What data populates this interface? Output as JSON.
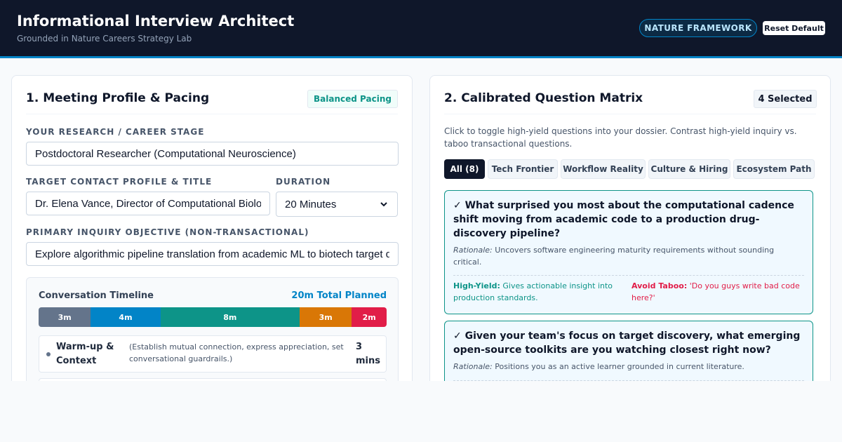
{
  "header": {
    "title": "Informational Interview Architect",
    "subtitle": "Grounded in Nature Careers Strategy Lab",
    "framework_badge": "NATURE FRAMEWORK",
    "reset_label": "Reset Default"
  },
  "colors": {
    "header_bg": "#0f172a",
    "accent": "#0284c7",
    "teal": "#0d9488",
    "rose": "#e11d48"
  },
  "profile": {
    "title": "1. Meeting Profile & Pacing",
    "pacing_badge": "Balanced Pacing",
    "stage_label": "YOUR RESEARCH / CAREER STAGE",
    "stage_value": "Postdoctoral Researcher (Computational Neuroscience)",
    "contact_label": "TARGET CONTACT PROFILE & TITLE",
    "contact_value": "Dr. Elena Vance, Director of Computational Biology",
    "duration_label": "DURATION",
    "duration_value": "20 Minutes",
    "objective_label": "PRIMARY INQUIRY OBJECTIVE (NON-TRANSACTIONAL)",
    "objective_value": "Explore algorithmic pipeline translation from academic ML to biotech target discovery"
  },
  "timeline": {
    "title": "Conversation Timeline",
    "total": "20m Total Planned",
    "segments": [
      {
        "label": "3m",
        "minutes": 3,
        "color": "#64748b"
      },
      {
        "label": "4m",
        "minutes": 4,
        "color": "#0284c7"
      },
      {
        "label": "8m",
        "minutes": 8,
        "color": "#0d9488"
      },
      {
        "label": "3m",
        "minutes": 3,
        "color": "#d97706"
      },
      {
        "label": "2m",
        "minutes": 2,
        "color": "#e11d48"
      }
    ],
    "phases": [
      {
        "name": "Warm-up & Context",
        "desc": "(Establish mutual connection, express appreciation, set conversational guardrails.)",
        "duration": "3 mins",
        "color": "#64748b"
      },
      {
        "name": "",
        "desc": "",
        "duration": "",
        "color": "#0284c7"
      }
    ]
  },
  "matrix": {
    "title": "2. Calibrated Question Matrix",
    "selected_badge": "4 Selected",
    "help": "Click to toggle high-yield questions into your dossier. Contrast high-yield inquiry vs. taboo transactional questions.",
    "tabs": [
      "All (8)",
      "Tech Frontier",
      "Workflow Reality",
      "Culture & Hiring",
      "Ecosystem Path"
    ],
    "active_tab": "All (8)",
    "questions": [
      {
        "text": "✓ What surprised you most about the computational cadence shift moving from academic code to a production drug-discovery pipeline?",
        "rationale_label": "Rationale:",
        "rationale": "Uncovers software engineering maturity requirements without sounding critical.",
        "yield_label": "High-Yield:",
        "yield": "Gives actionable insight into production standards.",
        "taboo_label": "Avoid Taboo:",
        "taboo": "'Do you guys write bad code here?'"
      },
      {
        "text": "✓ Given your team's focus on target discovery, what emerging open-source toolkits are you watching closest right now?",
        "rationale_label": "Rationale:",
        "rationale": "Positions you as an active learner grounded in current literature."
      }
    ]
  }
}
